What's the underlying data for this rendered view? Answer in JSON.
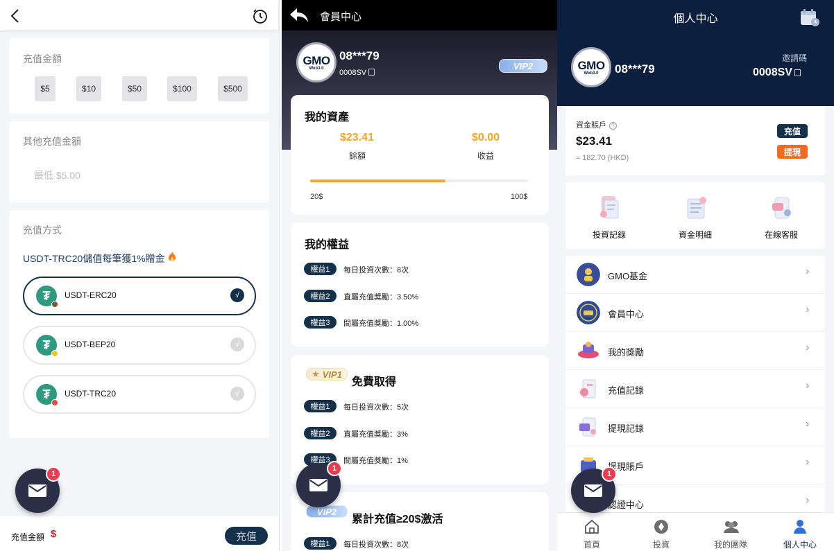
{
  "recharge": {
    "amount_title": "充值金額",
    "amounts": [
      "$5",
      "$10",
      "$50",
      "$100",
      "$500"
    ],
    "other_title": "其他充值金額",
    "other_placeholder": "最低 $5.00",
    "method_title": "充值方式",
    "promo": "USDT-TRC20儲值每筆獲1%贈金",
    "methods": [
      {
        "label": "USDT-ERC20",
        "selected": true,
        "check": "√"
      },
      {
        "label": "USDT-BEP20",
        "selected": false,
        "check": "√"
      },
      {
        "label": "USDT-TRC20",
        "selected": false,
        "check": "√"
      }
    ],
    "footer_label": "充值金額",
    "footer_currency": "$",
    "submit_label": "充值"
  },
  "mail_badge": "1",
  "member": {
    "title": "會員中心",
    "logo_main": "GMO",
    "logo_sub": "Web3.0",
    "username": "08***79",
    "code": "0008SV",
    "vip_badge": "VIP2",
    "assets_title": "我的資產",
    "balance_value": "$23.41",
    "balance_label": "餘額",
    "earnings_value": "$0.00",
    "earnings_label": "收益",
    "progress_min": "20$",
    "progress_max": "100$",
    "progress_fraction": 0.62,
    "rights_title": "我的權益",
    "rights": [
      {
        "tag": "權益1",
        "text": "每日投資次數：8次"
      },
      {
        "tag": "權益2",
        "text": "直屬充值獎勵：3.50%"
      },
      {
        "tag": "權益3",
        "text": "間屬充值獎勵：1.00%"
      }
    ],
    "vip1_badge": "VIP1",
    "vip1_title": "免費取得",
    "vip1_rights": [
      {
        "tag": "權益1",
        "text": "每日投資次數：5次"
      },
      {
        "tag": "權益2",
        "text": "直屬充值獎勵：3%"
      },
      {
        "tag": "權益3",
        "text": "間屬充值獎勵：1%"
      }
    ],
    "vip2_badge": "VIP2",
    "vip2_title": "累計充值≥20$激活",
    "vip2_rights": [
      {
        "tag": "權益1",
        "text": "每日投資次數：8次"
      }
    ]
  },
  "profile": {
    "title": "個人中心",
    "username": "08***79",
    "invite_label": "邀請碼",
    "invite_code": "0008SV",
    "account_label": "資金賬戶",
    "balance": "$23.41",
    "balance_hkd": "≈ 182.70 (HKD)",
    "deposit_label": "充值",
    "withdraw_label": "提現",
    "quick_links": [
      {
        "label": "投資記錄",
        "icon": "invest-record-icon"
      },
      {
        "label": "資金明細",
        "icon": "fund-detail-icon"
      },
      {
        "label": "在線客服",
        "icon": "customer-service-icon"
      }
    ],
    "menu": [
      {
        "label": "GMO基金",
        "icon": "gmo-fund-icon",
        "arrow": "›"
      },
      {
        "label": "會員中心",
        "icon": "vip-icon",
        "arrow": "›"
      },
      {
        "label": "我的獎勵",
        "icon": "rewards-icon",
        "arrow": "›"
      },
      {
        "label": "充值記錄",
        "icon": "recharge-record-icon",
        "arrow": "›"
      },
      {
        "label": "提現記錄",
        "icon": "withdraw-record-icon",
        "arrow": "›"
      },
      {
        "label": "提現賬戶",
        "icon": "withdraw-account-icon",
        "arrow": "›"
      },
      {
        "label": "認證中心",
        "icon": "verification-icon",
        "arrow": "›"
      }
    ],
    "tabs": [
      {
        "label": "首頁",
        "icon": "home-icon"
      },
      {
        "label": "投資",
        "icon": "invest-icon"
      },
      {
        "label": "我的團隊",
        "icon": "team-icon"
      },
      {
        "label": "個人中心",
        "icon": "profile-icon"
      }
    ]
  },
  "colors": {
    "navy": "#153049",
    "accent_orange": "#f5a623",
    "withdraw_orange": "#f26b24",
    "badge_red": "#f03a4f",
    "tether_green": "#2f9a7f"
  }
}
